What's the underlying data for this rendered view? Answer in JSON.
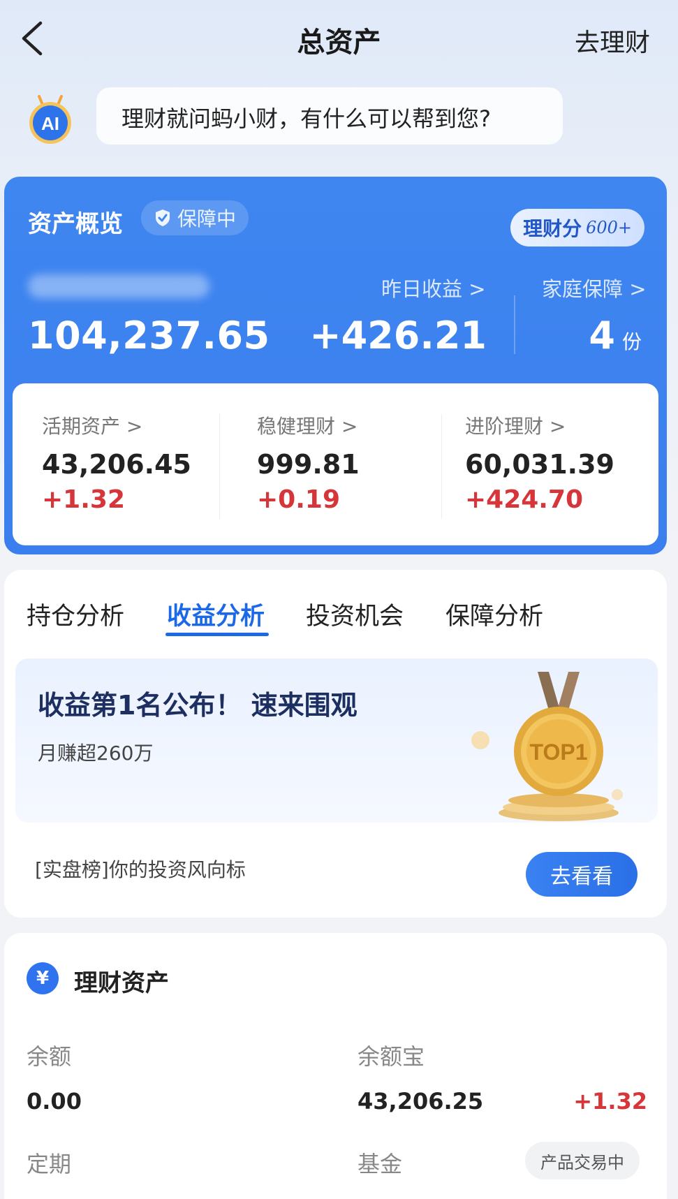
{
  "header": {
    "title": "总资产",
    "right_action": "去理财"
  },
  "ai": {
    "logo_text": "AI",
    "prompt": "理财就问蚂小财，有什么可以帮到您?"
  },
  "overview": {
    "title": "资产概览",
    "guard_badge": "保障中",
    "score_label": "理财分",
    "score_value": "600+",
    "total_value": "104,237.65",
    "yesterday_label": "昨日收益 >",
    "yesterday_value": "+426.21",
    "family_label": "家庭保障 >",
    "family_value": "4",
    "family_unit": "份",
    "items": [
      {
        "label": "活期资产 >",
        "value": "43,206.45",
        "change": "+1.32"
      },
      {
        "label": "稳健理财 >",
        "value": "999.81",
        "change": "+0.19"
      },
      {
        "label": "进阶理财 >",
        "value": "60,031.39",
        "change": "+424.70"
      }
    ]
  },
  "tabs": [
    {
      "label": "持仓分析",
      "active": false
    },
    {
      "label": "收益分析",
      "active": true
    },
    {
      "label": "投资机会",
      "active": false
    },
    {
      "label": "保障分析",
      "active": false
    }
  ],
  "promo": {
    "title": "收益第1名公布！ 速来围观",
    "subtitle": "月赚超260万",
    "medal_text": "TOP1",
    "footer": "[实盘榜]你的投资风向标",
    "button": "去看看"
  },
  "finance": {
    "icon": "¥",
    "title": "理财资产",
    "rows": [
      {
        "label": "余额",
        "value": "0.00"
      },
      {
        "label": "余额宝",
        "value": "43,206.25",
        "change": "+1.32"
      },
      {
        "label": "定期"
      },
      {
        "label": "基金",
        "badge": "产品交易中"
      }
    ]
  },
  "colors": {
    "accent": "#1c69e8",
    "card_blue": "#3f86f0",
    "gain_red": "#d6363a"
  }
}
